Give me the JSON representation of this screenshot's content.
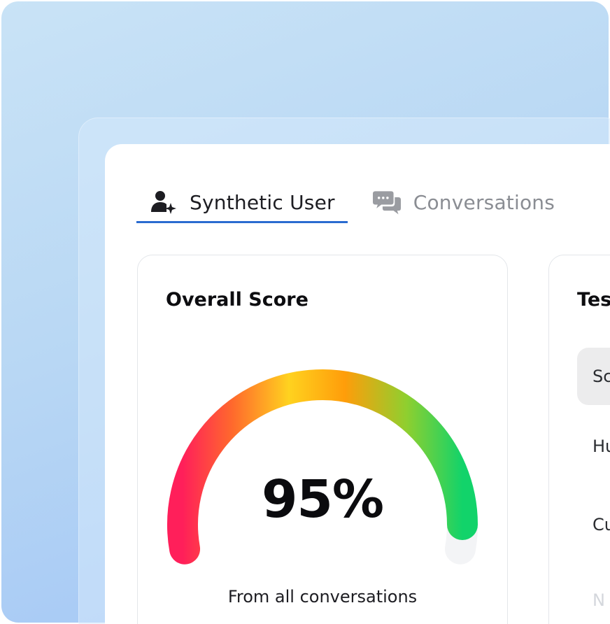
{
  "tabs": [
    {
      "label": "Synthetic User",
      "icon": "user-sparkle-icon",
      "active": true
    },
    {
      "label": "Conversations",
      "icon": "chat-bubbles-icon",
      "active": false
    }
  ],
  "score_card": {
    "title": "Overall Score",
    "value": "95%",
    "value_fraction": 0.95,
    "caption": "From all conversations",
    "gauge_colors": [
      "#ff1f5a",
      "#ff6a2c",
      "#ffd21f",
      "#ff9d0a",
      "#8fcf2f",
      "#12d36a"
    ],
    "track_color": "#f3f4f6"
  },
  "side_card": {
    "title": "Tes",
    "rows": [
      {
        "label": "Sc",
        "selected": true
      },
      {
        "label": "Hu",
        "selected": false
      },
      {
        "label": "Cu",
        "selected": false
      },
      {
        "label": "N",
        "selected": false,
        "faded": true
      }
    ]
  },
  "colors": {
    "accent": "#2a6bd0",
    "backdrop_top": "#c9e3f6",
    "backdrop_bottom": "#9fc3f6"
  }
}
